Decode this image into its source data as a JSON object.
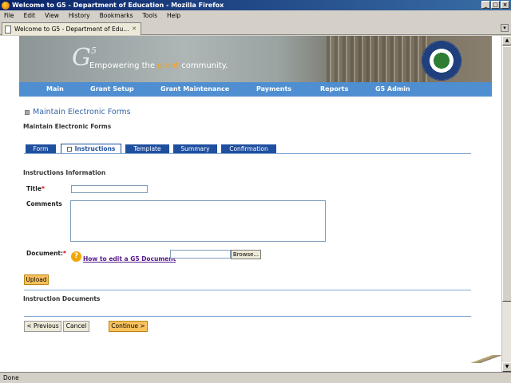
{
  "window": {
    "title": "Welcome to G5 - Department of Education - Mozilla Firefox"
  },
  "menu": [
    "File",
    "Edit",
    "View",
    "History",
    "Bookmarks",
    "Tools",
    "Help"
  ],
  "browser_tab": {
    "label": "Welcome to G5 - Department of Edu..."
  },
  "banner": {
    "logo": "G",
    "logo_sup": "5",
    "tagline_pre": "Empowering the ",
    "tagline_hl": "grant",
    "tagline_post": " community."
  },
  "nav": [
    "Main",
    "Grant Setup",
    "Grant Maintenance",
    "Payments",
    "Reports",
    "G5 Admin"
  ],
  "page": {
    "title": "Maintain Electronic Forms",
    "subtitle": "Maintain Electronic Forms"
  },
  "form_tabs": [
    "Form",
    "Instructions",
    "Template",
    "Summary",
    "Confirmation"
  ],
  "form": {
    "heading": "Instructions Information",
    "title_label": "Title",
    "comments_label": "Comments",
    "document_label": "Document:",
    "required_mark": "*",
    "help_link": "How to edit a G5 Document",
    "help_icon": "?",
    "browse_label": "Browse...",
    "upload_label": "Upload"
  },
  "docs_heading": "Instruction Documents",
  "buttons": {
    "previous": "< Previous",
    "cancel": "Cancel",
    "continue": "Continue >"
  },
  "status": "Done",
  "colors": {
    "nav": "#4f8fd1",
    "tab": "#1f4f9f",
    "accent_orange": "#f9c25e"
  }
}
